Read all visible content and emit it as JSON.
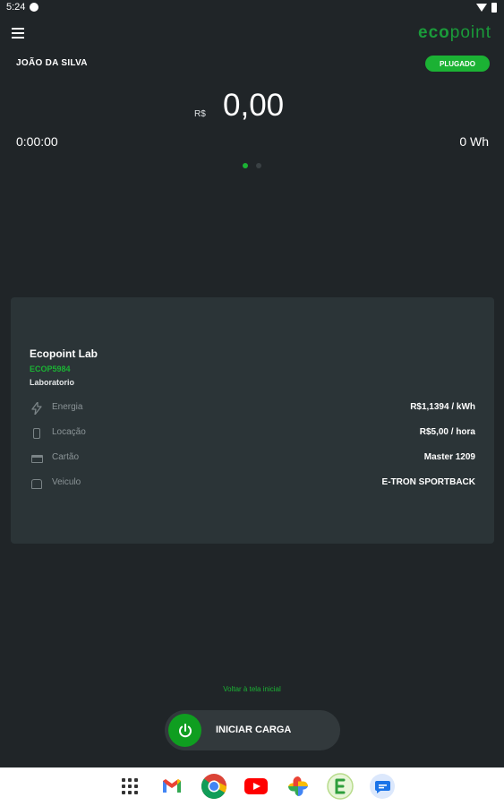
{
  "status_bar": {
    "time": "5:24"
  },
  "header": {
    "logo_text": "eco",
    "logo_text2": "point"
  },
  "user": {
    "name": "JOÃO DA SILVA",
    "plug_status": "PLUGADO"
  },
  "session": {
    "currency": "R$",
    "amount": "0,00",
    "elapsed": "0:00:00",
    "energy": "0 Wh"
  },
  "pager": {
    "active_index": 0,
    "pages": 2
  },
  "station": {
    "name": "Ecopoint Lab",
    "id": "ECOP5984",
    "category": "Laboratorio",
    "rows": [
      {
        "icon": "lightning-icon",
        "label": "Energia",
        "value": "R$1,1394 / kWh"
      },
      {
        "icon": "location-icon",
        "label": "Locação",
        "value": "R$5,00 / hora"
      },
      {
        "icon": "card-icon",
        "label": "Cartão",
        "value": "Master 1209"
      },
      {
        "icon": "vehicle-icon",
        "label": "Veiculo",
        "value": "E-TRON SPORTBACK"
      }
    ]
  },
  "actions": {
    "back_link": "Voltar à tela inicial",
    "start_label": "INICIAR CARGA"
  },
  "colors": {
    "accent": "#1bb234",
    "background": "#202528",
    "card": "#2b3437"
  },
  "dock": {
    "apps": [
      "apps-grid-icon",
      "gmail-icon",
      "chrome-icon",
      "youtube-icon",
      "photos-icon",
      "ecopoint-icon",
      "messages-icon"
    ]
  }
}
